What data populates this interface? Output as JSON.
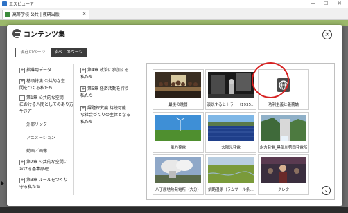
{
  "app": {
    "title": "エスビューア",
    "minimize": "—",
    "maximize": "☐",
    "close": "✕"
  },
  "doc_tab": {
    "label": "高等学校 公共 | 教研出版",
    "close": "×"
  },
  "dialog": {
    "title": "コンテンツ集",
    "close": "×",
    "scope": {
      "current": "現在のページ",
      "all": "すべてのページ"
    },
    "tree_left": [
      {
        "toggle": "+",
        "label": "指導用データ"
      },
      {
        "toggle": "+",
        "label": "巻頭特集 公共的な空"
      },
      {
        "toggle": "",
        "label": "間をつくる私たち"
      },
      {
        "toggle": "-",
        "label": "第1章 公共的な空間"
      },
      {
        "toggle": "",
        "label": "における人間としてのあり方"
      },
      {
        "toggle": "",
        "label": "生き方"
      },
      {
        "toggle": "+",
        "label": "第2章 公共的な空間に"
      },
      {
        "toggle": "",
        "label": "おける基本原理"
      },
      {
        "toggle": "+",
        "label": "第3章 ルールをつくり"
      },
      {
        "toggle": "",
        "label": "守る私たち"
      }
    ],
    "tree_left_sub": [
      "外部リンク",
      "アニメーション",
      "動画／画像"
    ],
    "tree_right": [
      {
        "toggle": "+",
        "label": "第4章 政治に参加する"
      },
      {
        "toggle": "",
        "label": "私たち"
      },
      {
        "toggle": "+",
        "label": "第5章 経済活動を行う"
      },
      {
        "toggle": "",
        "label": "私たち"
      },
      {
        "toggle": "+",
        "label": "課題探究編 持続可能"
      },
      {
        "toggle": "",
        "label": "な社会づくりの主体となる"
      },
      {
        "toggle": "",
        "label": "私たち"
      }
    ],
    "cards": [
      {
        "caption": "最後の晩餐",
        "thumb": "last-supper"
      },
      {
        "caption": "演説するヒトラー（1935…",
        "thumb": "hitler-speech"
      },
      {
        "caption": "功利主義と義務論",
        "thumb": "web-link-icon"
      },
      {
        "caption": "風力発電",
        "thumb": "wind-power"
      },
      {
        "caption": "太陽光発電",
        "thumb": "solar-power"
      },
      {
        "caption": "水力発電_黒部川第四発電所",
        "thumb": "hydro-power"
      },
      {
        "caption": "八丁原地熱発電所（大分）",
        "thumb": "geothermal"
      },
      {
        "caption": "釧路湿原（ラムサール条…",
        "thumb": "kushiro-marsh"
      },
      {
        "caption": "グレタ",
        "thumb": "greta"
      }
    ],
    "scroll_down": "⌄"
  },
  "colors": {
    "highlight_ring": "#d62020",
    "scope_selected": "#3c3c3c"
  }
}
